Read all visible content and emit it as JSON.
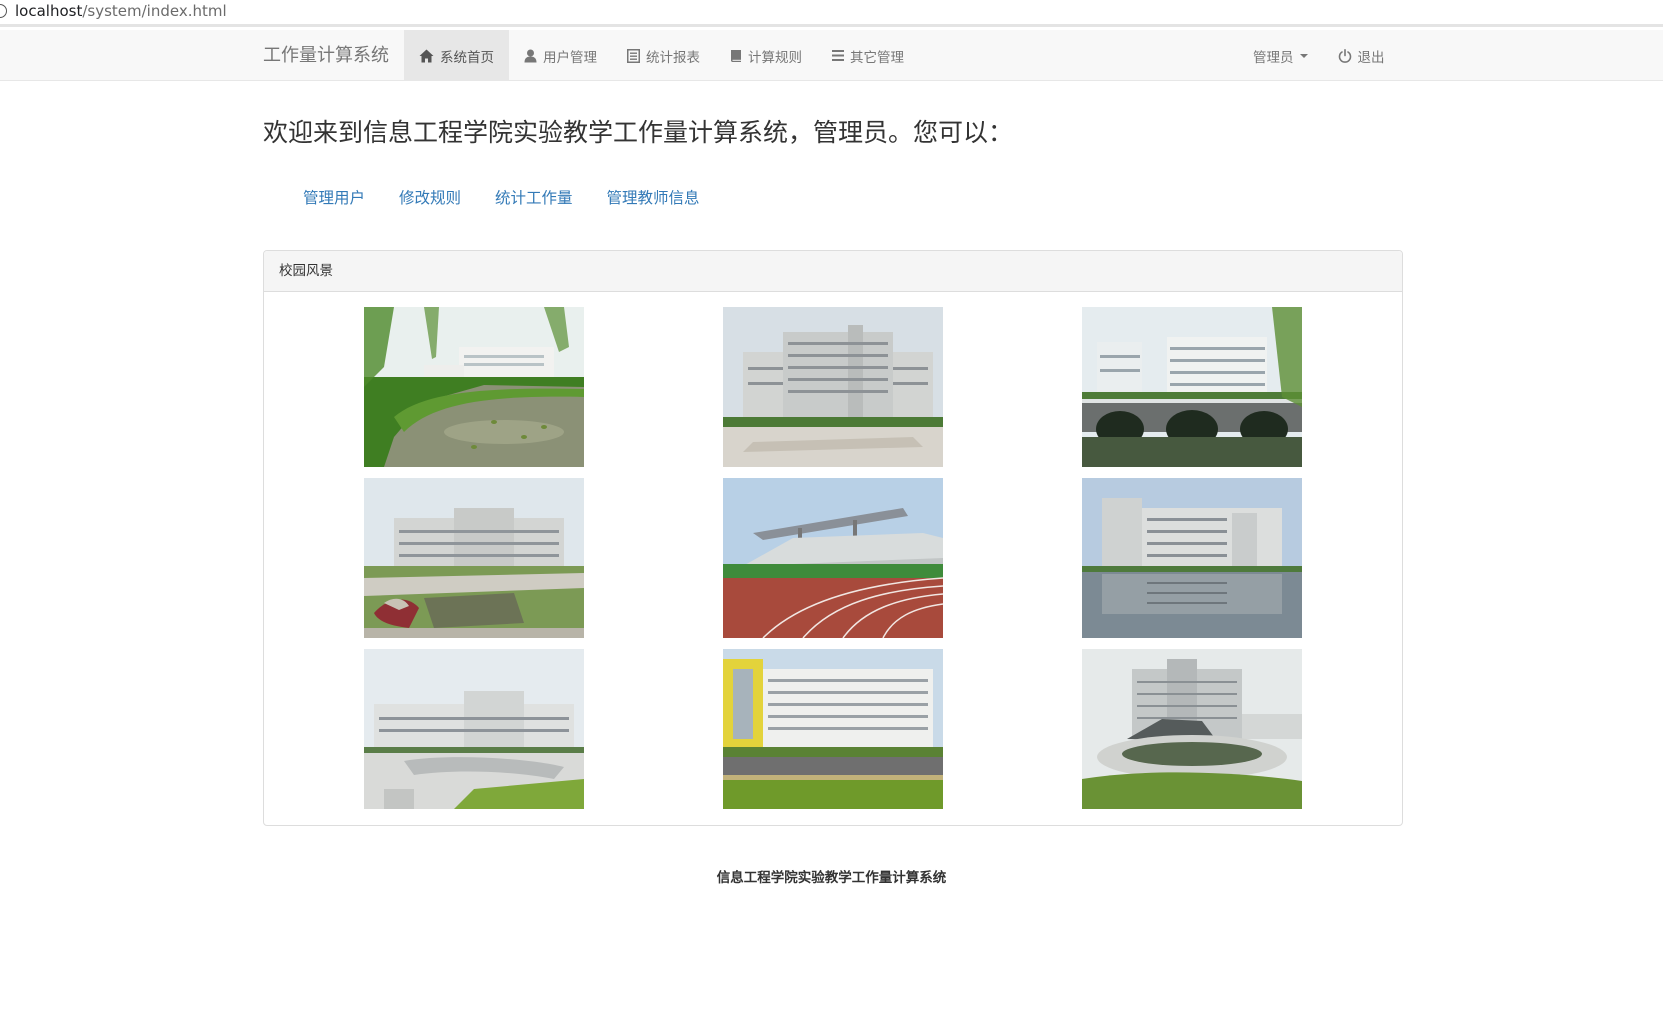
{
  "browser": {
    "url_host": "localhost",
    "url_path": "/system/index.html"
  },
  "navbar": {
    "brand": "工作量计算系统",
    "items": [
      {
        "label": "系统首页",
        "icon": "home-icon",
        "active": true
      },
      {
        "label": "用户管理",
        "icon": "user-icon",
        "active": false
      },
      {
        "label": "统计报表",
        "icon": "list-alt-icon",
        "active": false
      },
      {
        "label": "计算规则",
        "icon": "book-icon",
        "active": false
      },
      {
        "label": "其它管理",
        "icon": "menu-list-icon",
        "active": false
      }
    ],
    "user_menu": "管理员",
    "logout": "退出"
  },
  "main": {
    "welcome": "欢迎来到信息工程学院实验教学工作量计算系统，管理员。您可以：",
    "links": [
      "管理用户",
      "修改规则",
      "统计工作量",
      "管理教师信息"
    ]
  },
  "panel": {
    "title": "校园风景",
    "photos": [
      "campus-lake-photo",
      "campus-building-plaza-photo",
      "campus-bridge-dormitory-photo",
      "campus-building-garden-photo",
      "campus-stadium-track-photo",
      "campus-building-reflection-photo",
      "campus-building-square-photo",
      "campus-yellow-building-photo",
      "campus-tower-pond-photo"
    ]
  },
  "footer": {
    "text": "信息工程学院实验教学工作量计算系统"
  },
  "colors": {
    "link": "#337ab7",
    "navbar_bg": "#f8f8f8",
    "nav_active_bg": "#e7e7e7",
    "panel_heading_bg": "#f5f5f5"
  }
}
